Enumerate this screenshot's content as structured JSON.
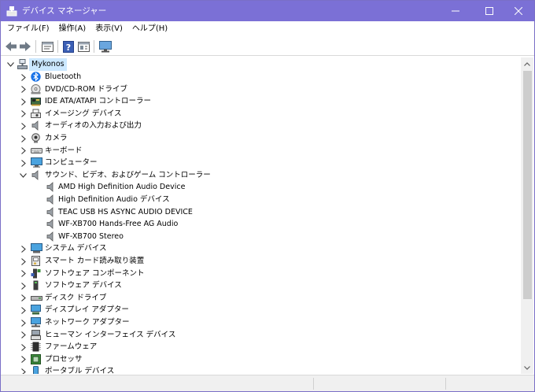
{
  "window": {
    "title": "デバイス マネージャー",
    "title_bar_color": "#7b70d6"
  },
  "menu": [
    {
      "label": "ファイル(F)"
    },
    {
      "label": "操作(A)"
    },
    {
      "label": "表示(V)"
    },
    {
      "label": "ヘルプ(H)"
    }
  ],
  "toolbar": {
    "buttons": [
      "back-arrow-icon",
      "forward-arrow-icon",
      "properties-icon",
      "help-icon",
      "view-details-icon",
      "display-monitor-icon"
    ]
  },
  "tree": {
    "root": {
      "label": "Mykonos",
      "expanded": true,
      "selected": true
    },
    "items": [
      {
        "label": "Bluetooth",
        "icon": "bluetooth-icon",
        "expanded": false
      },
      {
        "label": "DVD/CD-ROM ドライブ",
        "icon": "dvd-drive-icon",
        "expanded": false
      },
      {
        "label": "IDE ATA/ATAPI コントローラー",
        "icon": "ide-controller-icon",
        "expanded": false
      },
      {
        "label": "イメージング デバイス",
        "icon": "imaging-device-icon",
        "expanded": false
      },
      {
        "label": "オーディオの入力および出力",
        "icon": "audio-io-icon",
        "expanded": false
      },
      {
        "label": "カメラ",
        "icon": "camera-icon",
        "expanded": false
      },
      {
        "label": "キーボード",
        "icon": "keyboard-icon",
        "expanded": false
      },
      {
        "label": "コンピューター",
        "icon": "computer-icon",
        "expanded": false
      },
      {
        "label": "サウンド、ビデオ、およびゲーム コントローラー",
        "icon": "speaker-icon",
        "expanded": true,
        "children": [
          {
            "label": "AMD High Definition Audio Device",
            "icon": "speaker-icon"
          },
          {
            "label": "High Definition Audio デバイス",
            "icon": "speaker-icon"
          },
          {
            "label": "TEAC USB HS ASYNC AUDIO DEVICE",
            "icon": "speaker-icon"
          },
          {
            "label": "WF-XB700 Hands-Free AG Audio",
            "icon": "speaker-icon"
          },
          {
            "label": "WF-XB700 Stereo",
            "icon": "speaker-icon"
          }
        ]
      },
      {
        "label": "システム デバイス",
        "icon": "system-device-icon",
        "expanded": false
      },
      {
        "label": "スマート カード読み取り装置",
        "icon": "smart-card-reader-icon",
        "expanded": false
      },
      {
        "label": "ソフトウェア コンポーネント",
        "icon": "software-component-icon",
        "expanded": false
      },
      {
        "label": "ソフトウェア デバイス",
        "icon": "software-device-icon",
        "expanded": false
      },
      {
        "label": "ディスク ドライブ",
        "icon": "disk-drive-icon",
        "expanded": false
      },
      {
        "label": "ディスプレイ アダプター",
        "icon": "display-adapter-icon",
        "expanded": false
      },
      {
        "label": "ネットワーク アダプター",
        "icon": "network-adapter-icon",
        "expanded": false
      },
      {
        "label": "ヒューマン インターフェイス デバイス",
        "icon": "hid-icon",
        "expanded": false
      },
      {
        "label": "ファームウェア",
        "icon": "firmware-icon",
        "expanded": false
      },
      {
        "label": "プロセッサ",
        "icon": "processor-icon",
        "expanded": false
      },
      {
        "label": "ポータブル デバイス",
        "icon": "portable-device-icon",
        "expanded": false
      }
    ]
  },
  "colors": {
    "selection": "#cce8ff",
    "accent": "#7b70d6",
    "bluetooth": "#1a73e8"
  }
}
